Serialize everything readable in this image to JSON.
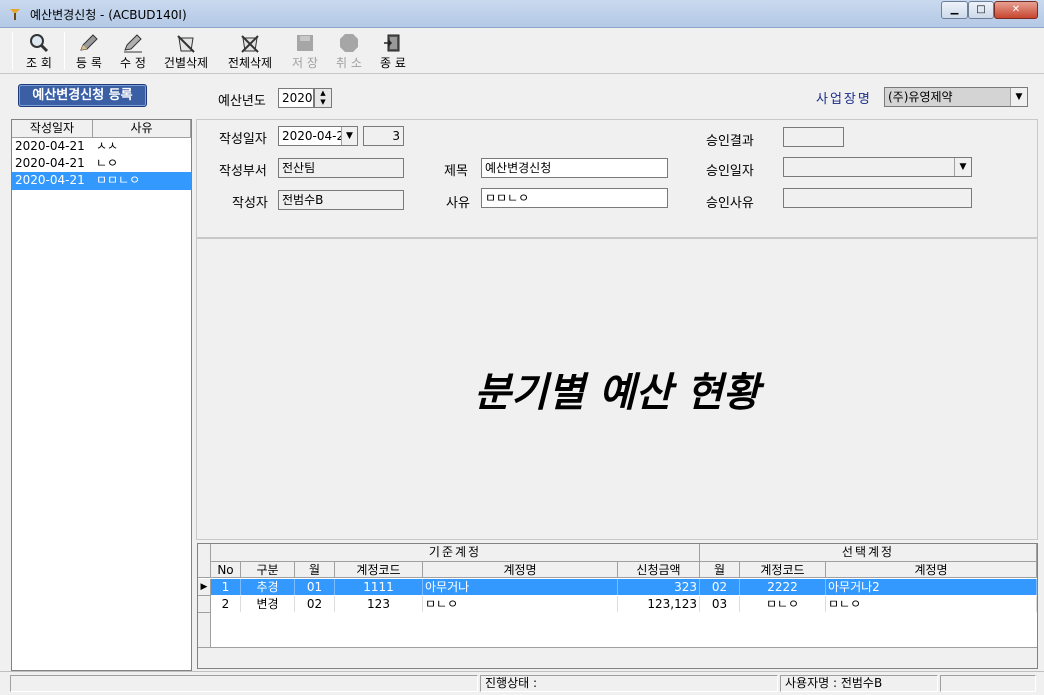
{
  "window": {
    "title": "예산변경신청 - (ACBUD140I)",
    "min": "▁",
    "max": "□",
    "close": "✕"
  },
  "toolbar": {
    "items": [
      {
        "label": "조 회",
        "icon": "magnifier-icon"
      },
      {
        "label": "등 록",
        "icon": "pencil-icon"
      },
      {
        "label": "수 정",
        "icon": "pencil-edit-icon"
      },
      {
        "label": "건별삭제",
        "icon": "delete-row-icon"
      },
      {
        "label": "전체삭제",
        "icon": "delete-all-icon"
      },
      {
        "label": "저 장",
        "icon": "save-icon"
      },
      {
        "label": "취 소",
        "icon": "cancel-icon"
      },
      {
        "label": "종 료",
        "icon": "exit-door-icon"
      }
    ]
  },
  "header": {
    "title_button": "예산변경신청 등록",
    "budget_year_label": "예산년도",
    "budget_year_value": "2020",
    "biz_label": "사업장명",
    "biz_value": "(주)유영제약"
  },
  "left_list": {
    "columns": [
      "작성일자",
      "사유"
    ],
    "rows": [
      {
        "date": "2020-04-21",
        "reason": "ㅅㅅ"
      },
      {
        "date": "2020-04-21",
        "reason": "ㄴㅇ"
      },
      {
        "date": "2020-04-21",
        "reason": "ㅁㅁㄴㅇ"
      }
    ]
  },
  "form": {
    "date_label": "작성일자",
    "date_value": "2020-04-2",
    "seq_value": "3",
    "dept_label": "작성부서",
    "dept_value": "전산팀",
    "author_label": "작성자",
    "author_value": "전범수B",
    "subject_label": "제목",
    "subject_value": "예산변경신청",
    "reason_label": "사유",
    "reason_value": "ㅁㅁㄴㅇ",
    "approval_result_label": "승인결과",
    "approval_result_value": "",
    "approval_date_label": "승인일자",
    "approval_date_value": "",
    "approval_reason_label": "승인사유",
    "approval_reason_value": ""
  },
  "panel": {
    "title": "분기별 예산 현황"
  },
  "grid": {
    "group_base": "기준계정",
    "group_selected": "선택계정",
    "columns": [
      "No",
      "구분",
      "월",
      "계정코드",
      "계정명",
      "신청금액",
      "월",
      "계정코드",
      "계정명"
    ],
    "rows": [
      {
        "no": "1",
        "type": "추경",
        "month": "01",
        "code": "1111",
        "name": "아무거나",
        "amount": "323",
        "month2": "02",
        "code2": "2222",
        "name2": "아무거나2"
      },
      {
        "no": "2",
        "type": "변경",
        "month": "02",
        "code": "123",
        "name": "ㅁㄴㅇ",
        "amount": "123,123",
        "month2": "03",
        "code2": "ㅁㄴㅇ",
        "name2": "ㅁㄴㅇ"
      }
    ]
  },
  "status": {
    "progress": "진행상태 :",
    "user": "사용자명 : 전범수B"
  },
  "colors": {
    "selection": "#3399ff",
    "header_button": "#3a5fa5",
    "biz_label": "#1c2f8c"
  }
}
